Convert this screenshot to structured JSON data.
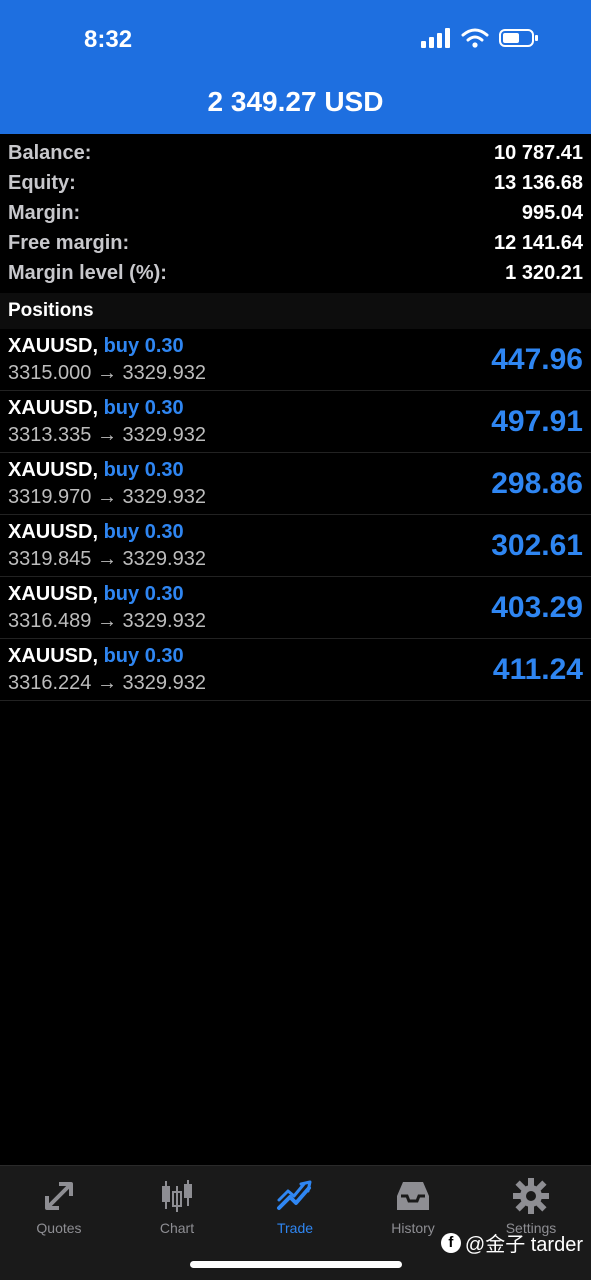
{
  "status": {
    "time": "8:32"
  },
  "header": {
    "title": "2 349.27 USD"
  },
  "summary": [
    {
      "label": "Balance:",
      "value": "10 787.41"
    },
    {
      "label": "Equity:",
      "value": "13 136.68"
    },
    {
      "label": "Margin:",
      "value": "995.04"
    },
    {
      "label": "Free margin:",
      "value": "12 141.64"
    },
    {
      "label": "Margin level (%):",
      "value": "1 320.21"
    }
  ],
  "positions_label": "Positions",
  "positions": [
    {
      "symbol": "XAUUSD,",
      "type": "buy 0.30",
      "prices": "3315.000 → 3329.932",
      "profit": "447.96"
    },
    {
      "symbol": "XAUUSD,",
      "type": "buy 0.30",
      "prices": "3313.335 → 3329.932",
      "profit": "497.91"
    },
    {
      "symbol": "XAUUSD,",
      "type": "buy 0.30",
      "prices": "3319.970 → 3329.932",
      "profit": "298.86"
    },
    {
      "symbol": "XAUUSD,",
      "type": "buy 0.30",
      "prices": "3319.845 → 3329.932",
      "profit": "302.61"
    },
    {
      "symbol": "XAUUSD,",
      "type": "buy 0.30",
      "prices": "3316.489 → 3329.932",
      "profit": "403.29"
    },
    {
      "symbol": "XAUUSD,",
      "type": "buy 0.30",
      "prices": "3316.224 → 3329.932",
      "profit": "411.24"
    }
  ],
  "tabs": [
    {
      "label": "Quotes",
      "icon": "quotes-arrows-icon"
    },
    {
      "label": "Chart",
      "icon": "candlestick-chart-icon"
    },
    {
      "label": "Trade",
      "icon": "trade-trend-icon",
      "active": true
    },
    {
      "label": "History",
      "icon": "inbox-tray-icon"
    },
    {
      "label": "Settings",
      "icon": "gear-icon"
    }
  ],
  "watermark": {
    "text": "@金子 tarder"
  },
  "colors": {
    "header_bg": "#1e6fe0",
    "accent": "#2f86f2",
    "background": "#000000"
  }
}
